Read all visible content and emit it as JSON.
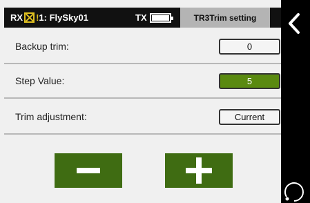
{
  "status_bar": {
    "rx_label": "RX",
    "rx_signal_icon": "rx-no-signal-icon",
    "warning_icon": "!",
    "model_name": "1: FlySky01",
    "tx_label": "TX",
    "tx_battery_icon": "battery-full-icon",
    "title": "TR3Trim setting"
  },
  "rows": [
    {
      "label": "Backup trim:",
      "value": "0",
      "active": false
    },
    {
      "label": "Step Value:",
      "value": "5",
      "active": true
    },
    {
      "label": "Trim adjustment:",
      "value": "Current",
      "active": false
    }
  ],
  "buttons": {
    "minus_icon": "minus-icon",
    "plus_icon": "plus-icon"
  },
  "side_panel": {
    "back_icon": "chevron-left-icon",
    "rotate_icon": "rotate-icon"
  },
  "colors": {
    "active_green": "#5a8a10",
    "button_green": "#3f6c12",
    "status_bar": "#111111",
    "title_bg": "#b4b4b4",
    "warning_yellow": "#e0c020"
  }
}
